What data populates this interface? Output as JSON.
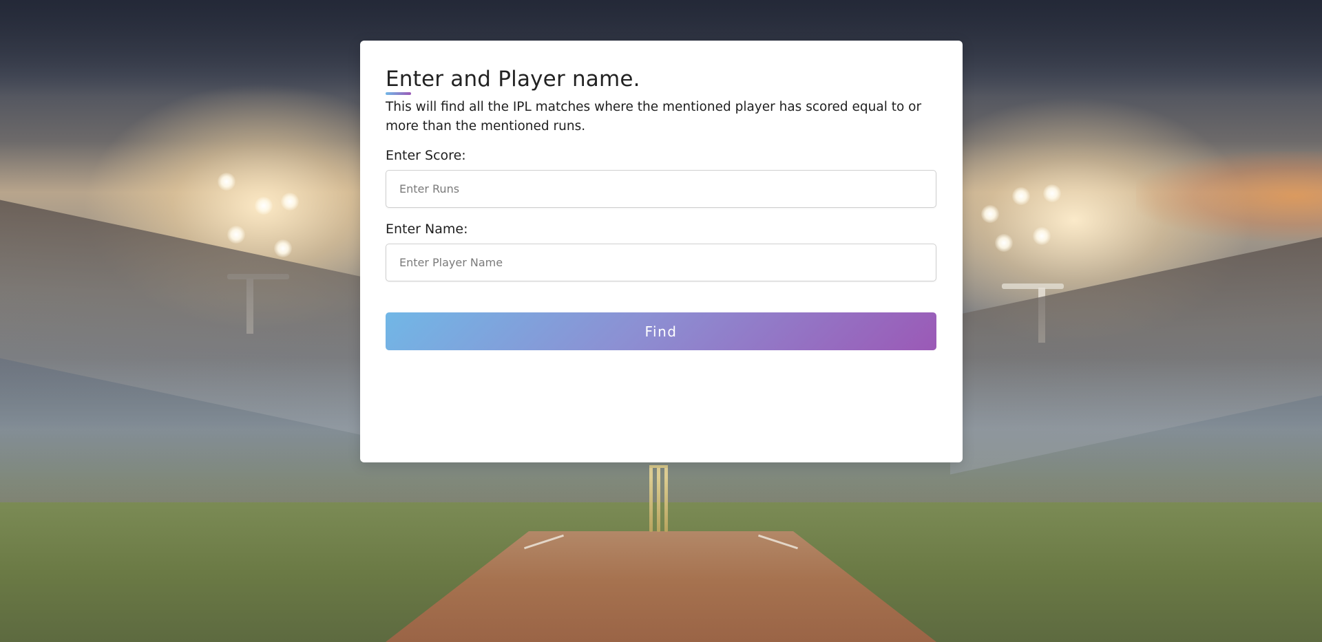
{
  "form": {
    "title": "Enter and Player name.",
    "description": "This will find all the IPL matches where the mentioned player has scored equal to or more than the mentioned runs.",
    "score_label": "Enter Score:",
    "score_placeholder": "Enter Runs",
    "name_label": "Enter Name:",
    "name_placeholder": "Enter Player Name",
    "find_label": "Find"
  },
  "colors": {
    "accent_start": "#71b7e6",
    "accent_end": "#9b59b6",
    "card_background": "#ffffff"
  }
}
